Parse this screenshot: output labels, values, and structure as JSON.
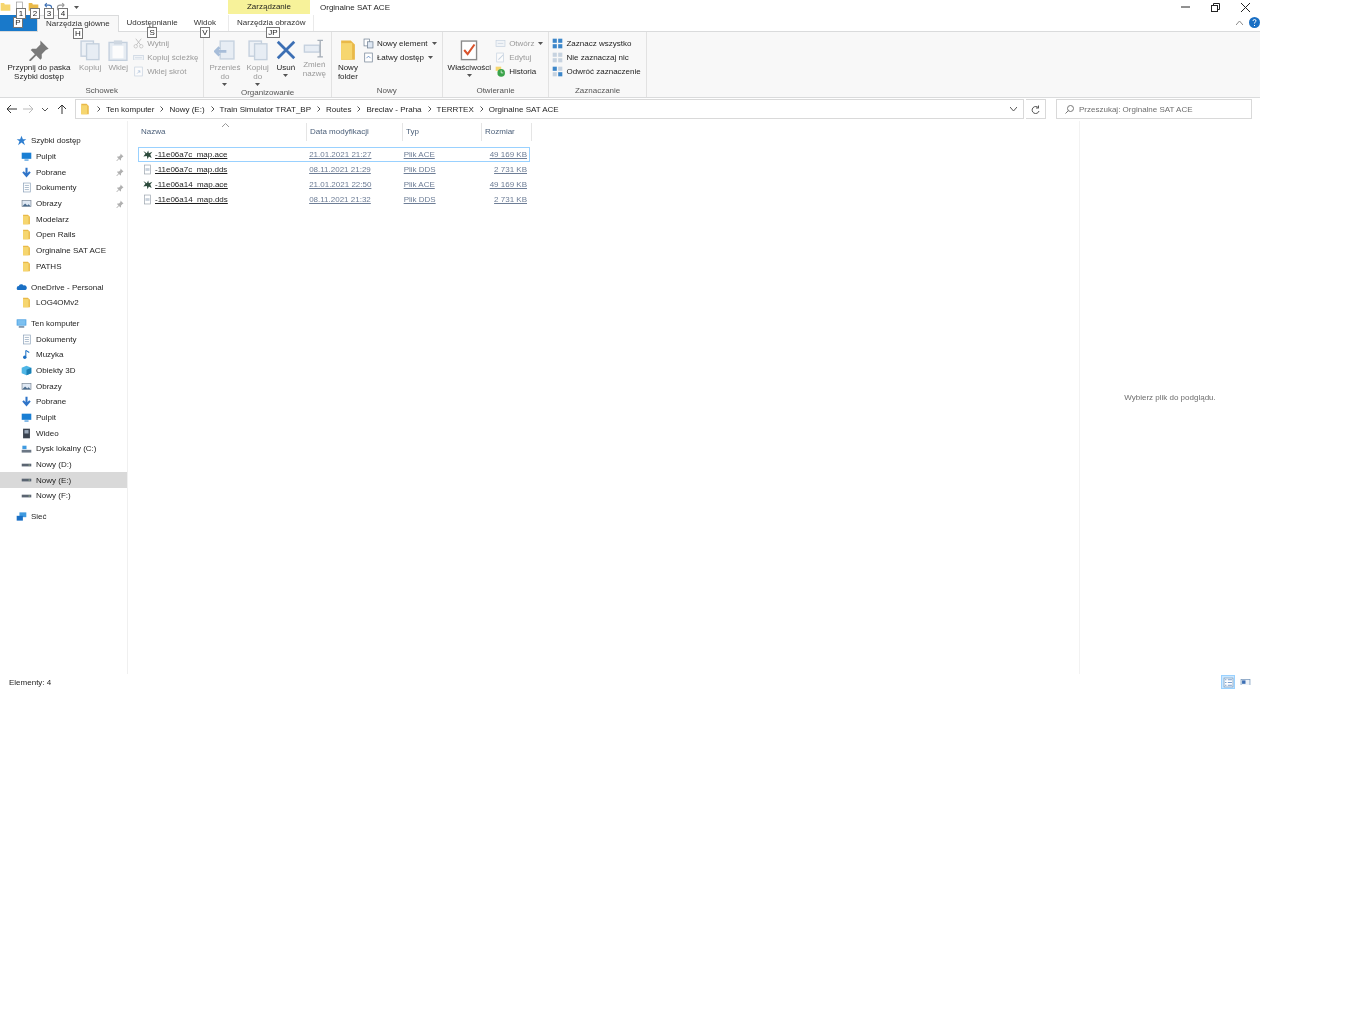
{
  "title_bar": {
    "quick_access_keytips": [
      "1",
      "2",
      "3",
      "4"
    ],
    "context_group": "Zarządzanie",
    "title": "Orginalne SAT ACE"
  },
  "ribbon_tabs": [
    {
      "kind": "file",
      "keytip": "P",
      "selected": false
    },
    {
      "kind": "tab",
      "label": "Narzędzia główne",
      "keytip": "H",
      "selected": true
    },
    {
      "kind": "tab",
      "label": "Udostępnianie",
      "keytip": "S",
      "selected": false
    },
    {
      "kind": "tab",
      "label": "Widok",
      "keytip": "V",
      "selected": false
    },
    {
      "kind": "context",
      "label": "Narzędzia obrazów",
      "keytip": "JP",
      "selected": false
    }
  ],
  "ribbon_groups": [
    {
      "label": "Schowek",
      "buttons": [
        {
          "kind": "large",
          "label": "Przypnij do paska Szybki dostęp",
          "disabled": false,
          "dropdown": false
        },
        {
          "kind": "large",
          "label": "Kopiuj",
          "disabled": true,
          "dropdown": false
        },
        {
          "kind": "large",
          "label": "Wklej",
          "disabled": true,
          "dropdown": false
        },
        {
          "kind": "small",
          "label": "Wytnij",
          "disabled": true,
          "dropdown": false
        },
        {
          "kind": "small",
          "label": "Kopiuj ścieżkę",
          "disabled": true,
          "dropdown": false
        },
        {
          "kind": "small",
          "label": "Wklej skrót",
          "disabled": true,
          "dropdown": false
        }
      ]
    },
    {
      "label": "Organizowanie",
      "buttons": [
        {
          "kind": "large",
          "label": "Przenieś do",
          "disabled": true,
          "dropdown": true
        },
        {
          "kind": "large",
          "label": "Kopiuj do",
          "disabled": true,
          "dropdown": true
        },
        {
          "kind": "large",
          "label": "Usuń",
          "disabled": false,
          "dropdown": true
        },
        {
          "kind": "large",
          "label": "Zmień nazwę",
          "disabled": true,
          "dropdown": false
        }
      ]
    },
    {
      "label": "Nowy",
      "buttons": [
        {
          "kind": "large",
          "label": "Nowy folder",
          "disabled": false,
          "dropdown": false
        },
        {
          "kind": "small",
          "label": "Nowy element",
          "disabled": false,
          "dropdown": true
        },
        {
          "kind": "small",
          "label": "Łatwy dostęp",
          "disabled": false,
          "dropdown": true
        }
      ]
    },
    {
      "label": "Otwieranie",
      "buttons": [
        {
          "kind": "large",
          "label": "Właściwości",
          "disabled": false,
          "dropdown": true
        },
        {
          "kind": "small",
          "label": "Otwórz",
          "disabled": true,
          "dropdown": true
        },
        {
          "kind": "small",
          "label": "Edytuj",
          "disabled": true,
          "dropdown": false
        },
        {
          "kind": "small",
          "label": "Historia",
          "disabled": false,
          "dropdown": false
        }
      ]
    },
    {
      "label": "Zaznaczanie",
      "buttons": [
        {
          "kind": "small",
          "label": "Zaznacz wszystko",
          "disabled": false,
          "dropdown": false
        },
        {
          "kind": "small",
          "label": "Nie zaznaczaj nic",
          "disabled": false,
          "dropdown": false
        },
        {
          "kind": "small",
          "label": "Odwróć zaznaczenie",
          "disabled": false,
          "dropdown": false
        }
      ]
    }
  ],
  "address_bar": {
    "breadcrumbs": [
      "Ten komputer",
      "Nowy (E:)",
      "Train Simulator TRAT_BP",
      "Routes",
      "Breclav - Praha",
      "TERRTEX",
      "Orginalne SAT ACE"
    ],
    "search_placeholder": "Przeszukaj: Orginalne SAT ACE"
  },
  "navigation": [
    {
      "label": "Szybki dostęp",
      "kind": "star",
      "selected": false,
      "children": [
        {
          "label": "Pulpit",
          "kind": "desktop",
          "pinned": true,
          "selected": false
        },
        {
          "label": "Pobrane",
          "kind": "download",
          "pinned": true,
          "selected": false
        },
        {
          "label": "Dokumenty",
          "kind": "documents",
          "pinned": true,
          "selected": false
        },
        {
          "label": "Obrazy",
          "kind": "pictures",
          "pinned": true,
          "selected": false
        },
        {
          "label": "Modelarz",
          "kind": "folder",
          "pinned": false,
          "selected": false
        },
        {
          "label": "Open Rails",
          "kind": "folder",
          "pinned": false,
          "selected": false
        },
        {
          "label": "Orginalne SAT ACE",
          "kind": "folder",
          "pinned": false,
          "selected": false
        },
        {
          "label": "PATHS",
          "kind": "folder",
          "pinned": false,
          "selected": false
        }
      ]
    },
    {
      "label": "OneDrive - Personal",
      "kind": "cloud",
      "selected": false,
      "children": [
        {
          "label": "LOG4OMv2",
          "kind": "folder",
          "selected": false
        }
      ]
    },
    {
      "label": "Ten komputer",
      "kind": "computer",
      "selected": false,
      "children": [
        {
          "label": "Dokumenty",
          "kind": "documents",
          "selected": false
        },
        {
          "label": "Muzyka",
          "kind": "music",
          "selected": false
        },
        {
          "label": "Obiekty 3D",
          "kind": "objects3d",
          "selected": false
        },
        {
          "label": "Obrazy",
          "kind": "pictures",
          "selected": false
        },
        {
          "label": "Pobrane",
          "kind": "download",
          "selected": false
        },
        {
          "label": "Pulpit",
          "kind": "desktop",
          "selected": false
        },
        {
          "label": "Wideo",
          "kind": "video",
          "selected": false
        },
        {
          "label": "Dysk lokalny (C:)",
          "kind": "drive_c",
          "selected": false
        },
        {
          "label": "Nowy (D:)",
          "kind": "drive",
          "selected": false
        },
        {
          "label": "Nowy (E:)",
          "kind": "drive",
          "selected": true
        },
        {
          "label": "Nowy (F:)",
          "kind": "drive",
          "selected": false
        }
      ]
    },
    {
      "label": "Sieć",
      "kind": "network",
      "selected": false
    }
  ],
  "file_list": {
    "columns": [
      {
        "label": "Nazwa",
        "sorted": true
      },
      {
        "label": "Data modyfikacji",
        "sorted": false
      },
      {
        "label": "Typ",
        "sorted": false
      },
      {
        "label": "Rozmiar",
        "sorted": false
      }
    ],
    "rows": [
      {
        "kind": "ace",
        "name": "-11e06a7c_map.ace",
        "date": "21.01.2021 21:27",
        "type": "Plik ACE",
        "size": "49 169 KB",
        "focused": true
      },
      {
        "kind": "dds",
        "name": "-11e06a7c_map.dds",
        "date": "08.11.2021 21:29",
        "type": "Plik DDS",
        "size": "2 731 KB",
        "focused": false
      },
      {
        "kind": "ace",
        "name": "-11e06a14_map.ace",
        "date": "21.01.2021 22:50",
        "type": "Plik ACE",
        "size": "49 169 KB",
        "focused": false
      },
      {
        "kind": "dds",
        "name": "-11e06a14_map.dds",
        "date": "08.11.2021 21:32",
        "type": "Plik DDS",
        "size": "2 731 KB",
        "focused": false
      }
    ]
  },
  "preview_pane": {
    "message": "Wybierz plik do podglądu."
  },
  "status_bar": {
    "item_count": "Elementy: 4",
    "views": [
      {
        "kind": "details",
        "selected": true
      },
      {
        "kind": "large_icons",
        "selected": false
      }
    ]
  }
}
